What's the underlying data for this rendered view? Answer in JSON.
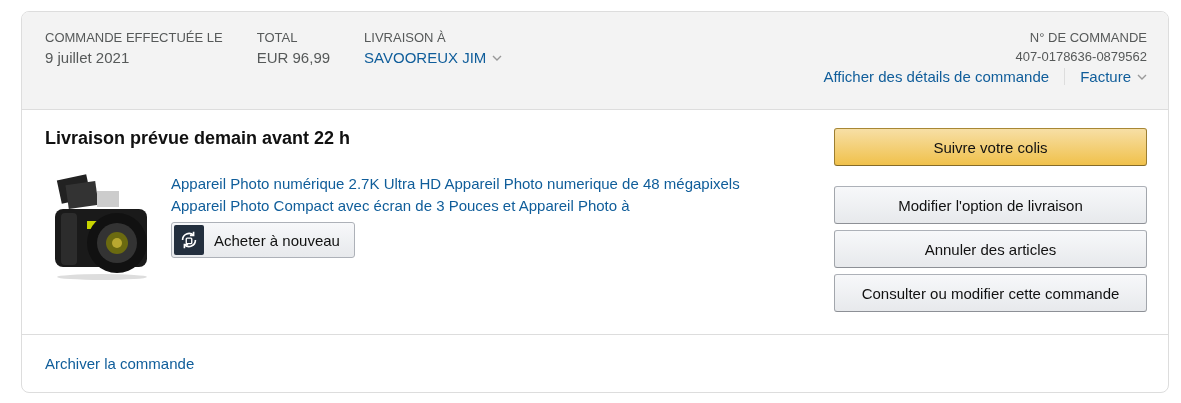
{
  "header": {
    "columns": [
      {
        "label": "COMMANDE EFFECTUÉE LE",
        "value": "9 juillet 2021",
        "kind": "text"
      },
      {
        "label": "TOTAL",
        "value": "EUR 96,99",
        "kind": "text"
      },
      {
        "label": "LIVRAISON À",
        "value": "SAVOOREUX JIM",
        "kind": "dropdown"
      }
    ],
    "order_number_label": "N° DE COMMANDE",
    "order_number": "407-0178636-0879562",
    "links": [
      {
        "label": "Afficher des détails de commande",
        "dropdown": false
      },
      {
        "label": "Facture",
        "dropdown": true
      }
    ]
  },
  "shipment": {
    "status": "Livraison prévue demain avant 22 h",
    "item": {
      "title": "Appareil Photo numérique 2.7K Ultra HD Appareil Photo numerique de 48 mégapixels Appareil Photo Compact avec écran de 3 Pouces et Appareil Photo à",
      "buy_again": "Acheter à nouveau"
    },
    "actions": [
      {
        "label": "Suivre votre colis",
        "kind": "primary"
      },
      {
        "label": "Modifier l'option de livraison",
        "kind": "secondary"
      },
      {
        "label": "Annuler des articles",
        "kind": "secondary"
      },
      {
        "label": "Consulter ou modifier cette commande",
        "kind": "secondary"
      }
    ]
  },
  "footer": {
    "link": "Archiver la commande"
  }
}
